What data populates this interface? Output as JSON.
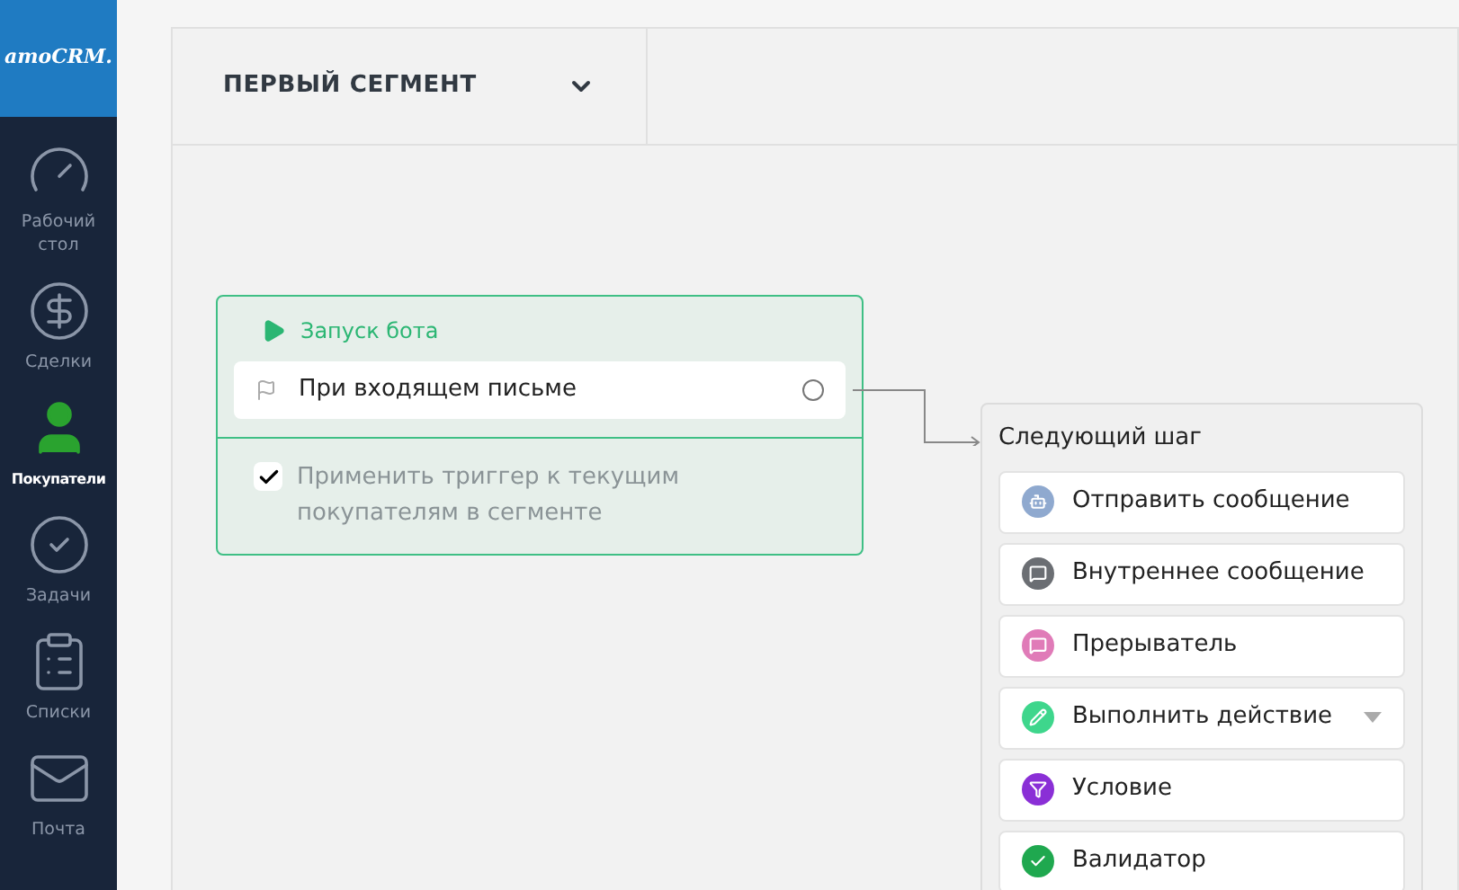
{
  "logo": "amoCRM.",
  "sidebar": {
    "items": [
      {
        "label": "Рабочий стол",
        "selected": false
      },
      {
        "label": "Сделки",
        "selected": false
      },
      {
        "label": "Покупатели",
        "selected": true
      },
      {
        "label": "Задачи",
        "selected": false
      },
      {
        "label": "Списки",
        "selected": false
      },
      {
        "label": "Почта",
        "selected": false
      }
    ]
  },
  "segment": {
    "title": "ПЕРВЫЙ СЕГМЕНТ"
  },
  "trigger_card": {
    "title": "Запуск бота",
    "trigger": "При входящем письме",
    "apply_existing": {
      "label": "Применить триггер к текущим покупателям в сегменте",
      "checked": true
    }
  },
  "next_step": {
    "title": "Следующий шаг",
    "items": [
      {
        "label": "Отправить сообщение",
        "color": "#8fa9cf",
        "has_menu": false
      },
      {
        "label": "Внутреннее сообщение",
        "color": "#6b6e73",
        "has_menu": false
      },
      {
        "label": "Прерыватель",
        "color": "#e07bb8",
        "has_menu": false
      },
      {
        "label": "Выполнить действие",
        "color": "#3ed68c",
        "has_menu": true
      },
      {
        "label": "Условие",
        "color": "#8a2fd6",
        "has_menu": false
      },
      {
        "label": "Валидатор",
        "color": "#1fa84f",
        "has_menu": false
      }
    ]
  }
}
